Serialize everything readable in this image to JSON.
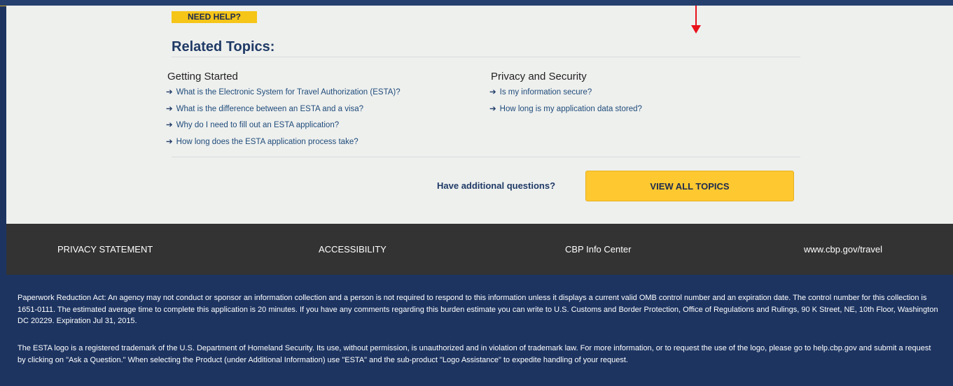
{
  "help": {
    "badge": "NEED HELP?",
    "title": "Related Topics:",
    "columns": [
      {
        "heading": "Getting Started",
        "links": [
          "What is the Electronic System for Travel Authorization (ESTA)?",
          "What is the difference between an ESTA and a visa?",
          "Why do I need to fill out an ESTA application?",
          "How long does the ESTA application process take?"
        ]
      },
      {
        "heading": "Privacy and Security",
        "links": [
          "Is my information secure?",
          "How long is my application data stored?"
        ]
      }
    ],
    "link_arrow": "➔",
    "questions_label": "Have additional questions?",
    "view_all_label": "VIEW ALL TOPICS"
  },
  "footer": {
    "links": [
      "PRIVACY STATEMENT",
      "ACCESSIBILITY",
      "CBP Info Center",
      "www.cbp.gov/travel"
    ],
    "paperwork_notice": "Paperwork Reduction Act: An agency may not conduct or sponsor an information collection and a person is not required to respond to this information unless it displays a current valid OMB control number and an expiration date. The control number for this collection is 1651-0111. The estimated average time to complete this application is 20 minutes. If you have any comments regarding this burden estimate you can write to U.S. Customs and Border Protection, Office of Regulations and Rulings, 90 K Street, NE, 10th Floor, Washington DC 20229. Expiration Jul 31, 2015.",
    "trademark_notice": "The ESTA logo is a registered trademark of the U.S. Department of Homeland Security. Its use, without permission, is unauthorized and in violation of trademark law. For more information, or to request the use of the logo, please go to help.cbp.gov and submit a request by clicking on \"Ask a Question.\" When selecting the Product (under Additional Information) use \"ESTA\" and the sub-product \"Logo Assistance\" to expedite handling of your request."
  },
  "colors": {
    "navy": "#1d3461",
    "accent_yellow": "#fdc830",
    "footer_dark": "#333333",
    "marker_red": "#e8121b"
  },
  "icons": {
    "link_arrow": "right-arrow-icon",
    "marker": "red-down-arrow-icon"
  }
}
